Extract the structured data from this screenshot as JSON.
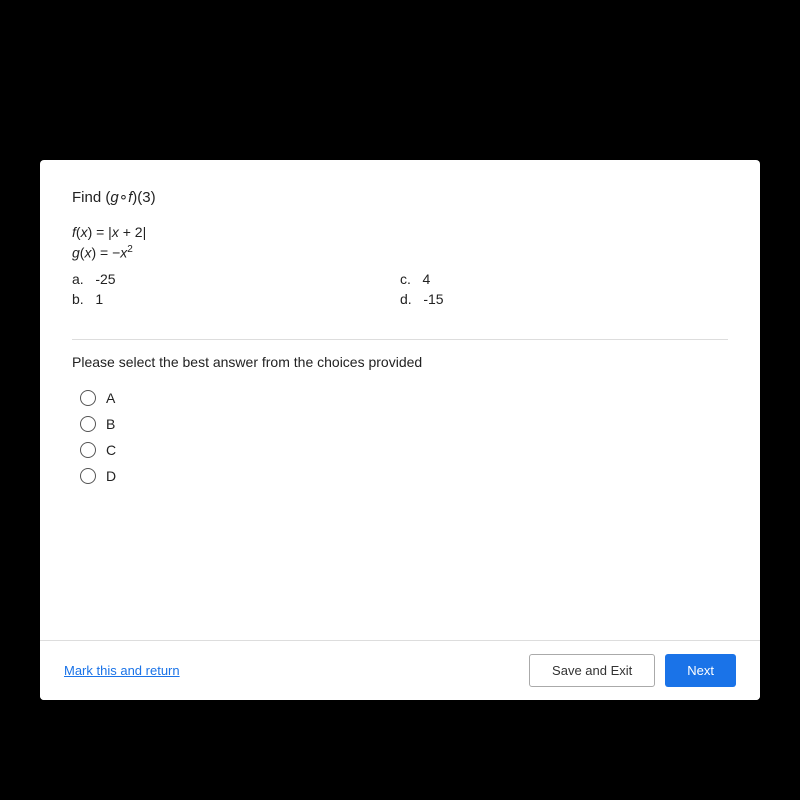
{
  "question": {
    "title": "Find (g∘f)(3)",
    "functions": [
      "f(x) = |x + 2|",
      "g(x) = −x²"
    ],
    "choices": [
      {
        "letter": "a.",
        "value": "-25"
      },
      {
        "letter": "b.",
        "value": "1"
      },
      {
        "letter": "c.",
        "value": "4"
      },
      {
        "letter": "d.",
        "value": "-15"
      }
    ],
    "instruction": "Please select the best answer from the choices provided",
    "radio_options": [
      "A",
      "B",
      "C",
      "D"
    ]
  },
  "footer": {
    "mark_link": "Mark this and return",
    "save_exit": "Save and Exit",
    "next": "Next"
  }
}
